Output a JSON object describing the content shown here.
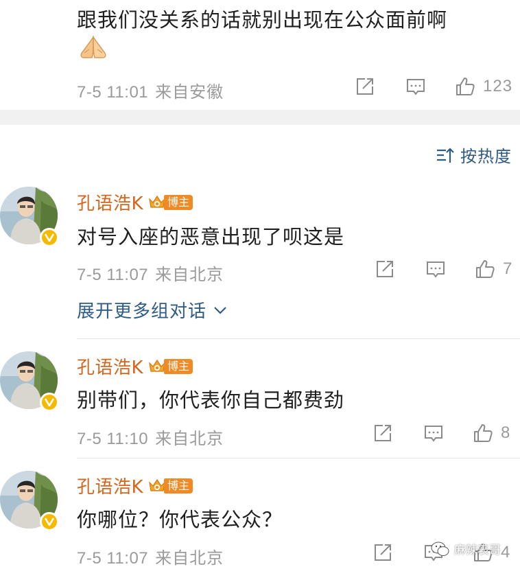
{
  "top_comment": {
    "text": "跟我们没关系的话就别出现在公众面前啊",
    "time": "7-5 11:01",
    "source": "来自安徽",
    "likes": "123"
  },
  "sort": {
    "label": "按热度"
  },
  "comments": [
    {
      "username": "孔语浩K",
      "badge": "博主",
      "text": "对号入座的恶意出现了呗这是",
      "time": "7-5 11:07",
      "source": "来自北京",
      "likes": "7"
    },
    {
      "username": "孔语浩K",
      "badge": "博主",
      "text": "别带们，你代表你自己都费劲",
      "time": "7-5 11:10",
      "source": "来自北京",
      "likes": "8"
    },
    {
      "username": "孔语浩K",
      "badge": "博主",
      "text": "你哪位？你代表公众？",
      "time": "7-5 11:07",
      "source": "来自北京",
      "likes": "4"
    }
  ],
  "expand_label": "展开更多组对话",
  "watermark": "麻辣表哥",
  "colors": {
    "username": "#d4651c",
    "link": "#2e5b86",
    "meta": "#9a9a9a",
    "badge": "#f08a24",
    "verified": "#f5b900"
  },
  "icons": [
    "share-icon",
    "comment-icon",
    "like-icon",
    "sort-icon",
    "chevron-down-icon",
    "verified-icon",
    "crown-icon",
    "folded-hands-emoji",
    "wechat-icon"
  ]
}
